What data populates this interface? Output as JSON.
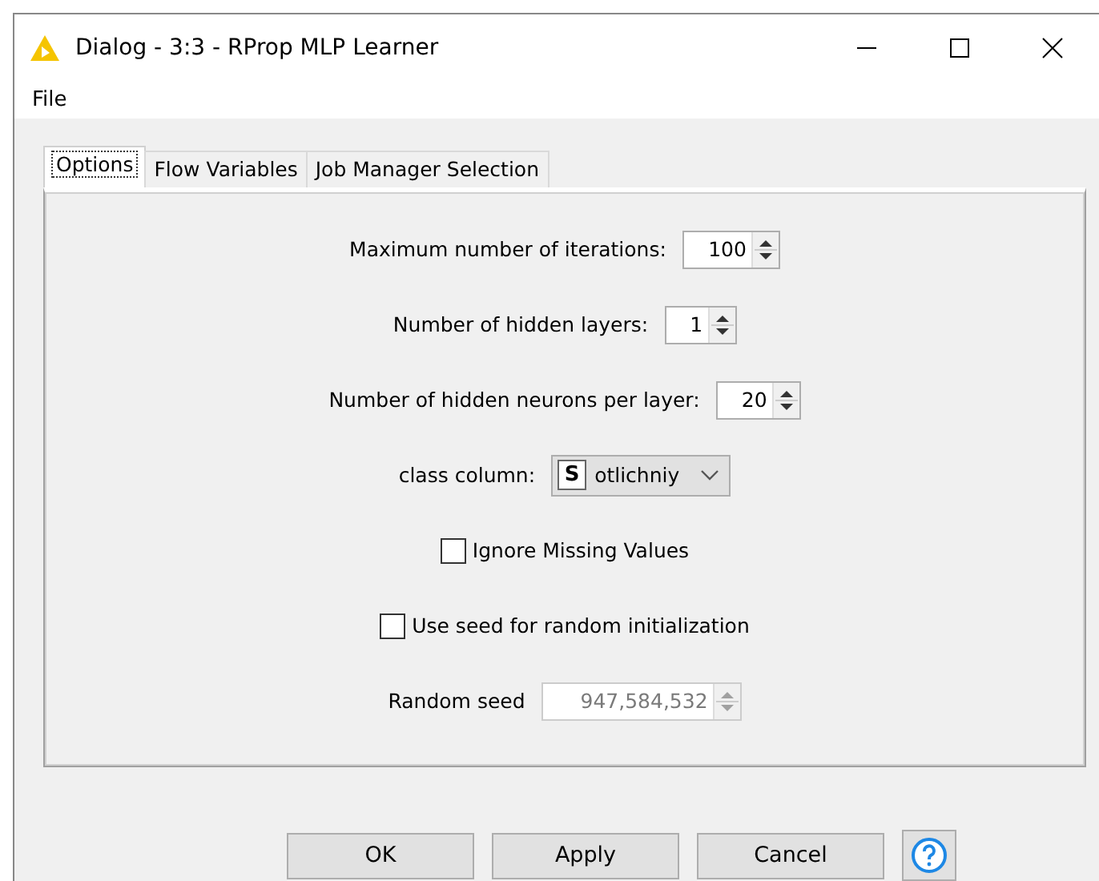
{
  "window": {
    "title": "Dialog - 3:3 - RProp MLP Learner"
  },
  "menu": [
    "File"
  ],
  "tabs": [
    {
      "label": "Options",
      "selected": true
    },
    {
      "label": "Flow Variables",
      "selected": false
    },
    {
      "label": "Job Manager Selection",
      "selected": false
    }
  ],
  "fields": [
    {
      "kind": "spinner",
      "label": "Maximum number of iterations:",
      "value": "100",
      "disabled": false
    },
    {
      "kind": "spinner",
      "label": "Number of hidden layers:",
      "value": "1",
      "disabled": false
    },
    {
      "kind": "spinner",
      "label": "Number of hidden neurons per layer:",
      "value": "20",
      "disabled": false
    },
    {
      "kind": "combo",
      "label": "class column:",
      "type_badge": "S",
      "value": "otlichniy"
    },
    {
      "kind": "checkbox",
      "label": "Ignore Missing Values",
      "checked": false
    },
    {
      "kind": "checkbox",
      "label": "Use seed for random initialization",
      "checked": false
    },
    {
      "kind": "spinner",
      "label": "Random seed",
      "value": "947,584,532",
      "disabled": true
    }
  ],
  "buttons": [
    "OK",
    "Apply",
    "Cancel"
  ]
}
